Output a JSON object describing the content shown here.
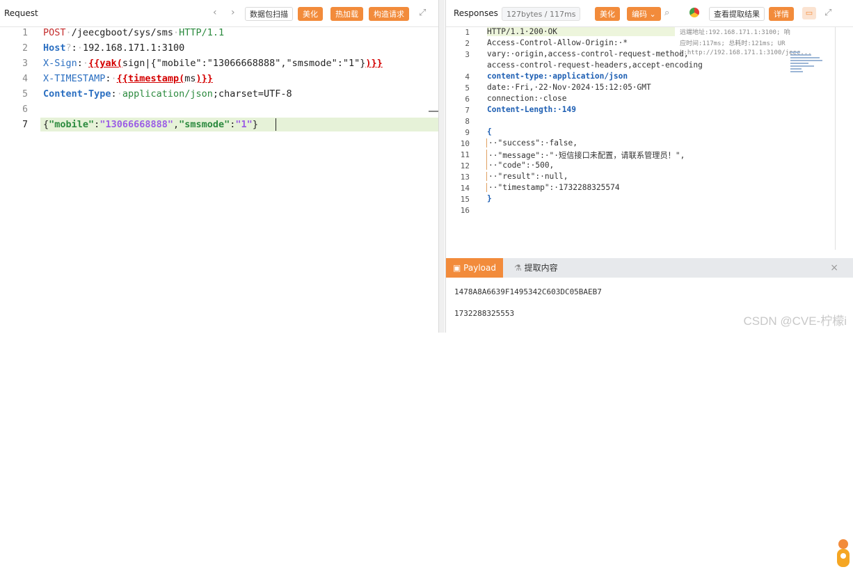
{
  "request": {
    "title": "Request",
    "nav_back": "‹",
    "nav_forward": "›",
    "scan_button": "数据包扫描",
    "beautify_button": "美化",
    "hotload_button": "热加载",
    "build_request_button": "构造请求",
    "lines": [
      {
        "n": "1",
        "segs": [
          [
            "kw",
            "POST"
          ],
          [
            "dot",
            "·"
          ],
          [
            "dark",
            "/jeecgboot/sys/sms"
          ],
          [
            "dot",
            "·"
          ],
          [
            "grn",
            "HTTP/1.1"
          ]
        ]
      },
      {
        "n": "2",
        "segs": [
          [
            "hdb",
            "Host"
          ],
          [
            "dot",
            "?"
          ],
          [
            "dark",
            ":"
          ],
          [
            "dot",
            "·"
          ],
          [
            "dark",
            "192.168.171.1:3100"
          ]
        ]
      },
      {
        "n": "3",
        "segs": [
          [
            "hd",
            "X-Sign"
          ],
          [
            "dark",
            ":"
          ],
          [
            "dot",
            "·"
          ],
          [
            "tpl",
            "{{yak("
          ],
          [
            "dark",
            "sign|{\"mobile\":\"13066668888\",\"smsmode\":\"1\"}"
          ],
          [
            "tpl",
            ")}}"
          ]
        ]
      },
      {
        "n": "4",
        "segs": [
          [
            "hd",
            "X-TIMESTAMP"
          ],
          [
            "dark",
            ":"
          ],
          [
            "dot",
            "·"
          ],
          [
            "tpl",
            "{{timestamp("
          ],
          [
            "dark",
            "ms"
          ],
          [
            "tpl",
            ")}}"
          ]
        ]
      },
      {
        "n": "5",
        "segs": [
          [
            "hdb",
            "Content-Type"
          ],
          [
            "dark",
            ":"
          ],
          [
            "dot",
            "·"
          ],
          [
            "grn",
            "application/json"
          ],
          [
            "dark",
            ";charset=UTF-8"
          ]
        ]
      },
      {
        "n": "6",
        "segs": []
      },
      {
        "n": "7",
        "segs": [
          [
            "dark",
            "{"
          ],
          [
            "jk",
            "\"mobile\""
          ],
          [
            "dark",
            ":"
          ],
          [
            "jv",
            "\"13066668888\""
          ],
          [
            "dark",
            ","
          ],
          [
            "jk",
            "\"smsmode\""
          ],
          [
            "dark",
            ":"
          ],
          [
            "jv",
            "\"1\""
          ],
          [
            "dark",
            "}"
          ]
        ]
      }
    ]
  },
  "response": {
    "title": "Responses",
    "size_badge": "127bytes / 117ms",
    "beautify_button": "美化",
    "encoding_button": "编码",
    "view_extract_button": "查看提取结果",
    "details_button": "详情",
    "meta_remote": "远端地址:192.168.171.1:3100; 响",
    "meta_time": "应时间:117ms; 总耗时:121ms; UR",
    "meta_url": "L:http://192.168.171.1:3100/jeec...",
    "lines": [
      {
        "n": "1",
        "t": "HTTP/1.1·200·OK",
        "cls": "rfirst"
      },
      {
        "n": "2",
        "t": "Access-Control-Allow-Origin:·*",
        "cls": ""
      },
      {
        "n": "3",
        "t": "vary:·origin,access-control-request-method,",
        "cls": ""
      },
      {
        "n": "",
        "t": "access-control-request-headers,accept-encoding",
        "cls": ""
      },
      {
        "n": "4",
        "t": "content-type:·application/json",
        "cls": "rblue"
      },
      {
        "n": "5",
        "t": "date:·Fri,·22·Nov·2024·15:12:05·GMT",
        "cls": ""
      },
      {
        "n": "6",
        "t": "connection:·close",
        "cls": ""
      },
      {
        "n": "7",
        "t": "Content-Length:·149",
        "cls": "rblue"
      },
      {
        "n": "8",
        "t": "",
        "cls": ""
      },
      {
        "n": "9",
        "t": "{",
        "cls": "rblue"
      },
      {
        "n": "10",
        "t": "··\"success\":·false,",
        "cls": ""
      },
      {
        "n": "11",
        "t": "··\"message\":·\"·短信接口未配置，请联系管理员！\",",
        "cls": ""
      },
      {
        "n": "12",
        "t": "··\"code\":·500,",
        "cls": ""
      },
      {
        "n": "13",
        "t": "··\"result\":·null,",
        "cls": ""
      },
      {
        "n": "14",
        "t": "··\"timestamp\":·1732288325574",
        "cls": ""
      },
      {
        "n": "15",
        "t": "}",
        "cls": "rblue"
      },
      {
        "n": "16",
        "t": "",
        "cls": ""
      }
    ]
  },
  "bottom": {
    "payload_tab": "Payload",
    "extract_tab": "提取内容",
    "payload_lines": [
      "1478A8A6639F1495342C603DC05BAEB7",
      "1732288325553"
    ]
  },
  "watermark": "CSDN @CVE-柠檬i",
  "colors": {
    "accent": "#f28b3b",
    "template_red": "#d40000",
    "header_blue": "#2b6fc1"
  }
}
